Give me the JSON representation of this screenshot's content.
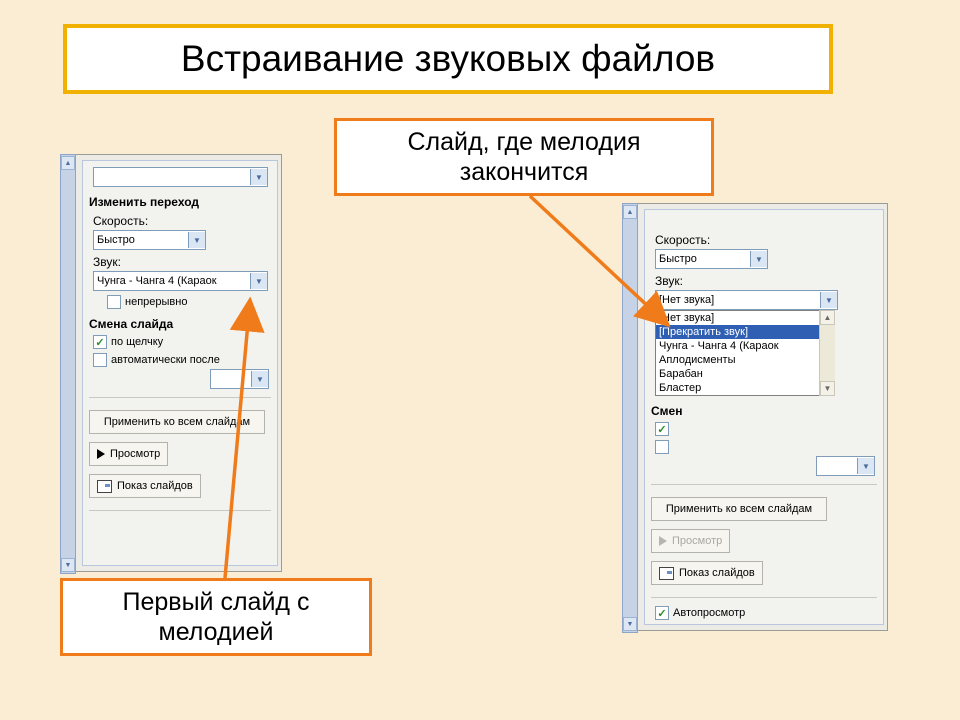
{
  "title": "Встраивание звуковых файлов",
  "callouts": {
    "top": "Слайд, где мелодия закончится",
    "bottom": "Первый слайд с мелодией"
  },
  "colors": {
    "accent": "#f07b1a",
    "title_border": "#f1b100"
  },
  "left_panel": {
    "section_transition": "Изменить переход",
    "speed_label": "Скорость:",
    "speed_value": "Быстро",
    "sound_label": "Звук:",
    "sound_value": "Чунга - Чанга 4 (Караок",
    "loop_label": "непрерывно",
    "loop_checked": false,
    "section_advance": "Смена слайда",
    "advance_click": "по щелчку",
    "advance_click_checked": true,
    "advance_auto": "автоматически после",
    "advance_auto_checked": false,
    "apply_all": "Применить ко всем слайдам",
    "play": "Просмотр",
    "slideshow": "Показ слайдов"
  },
  "right_panel": {
    "speed_label": "Скорость:",
    "speed_value": "Быстро",
    "sound_label": "Звук:",
    "sound_value": "[Нет звука]",
    "dropdown_options": [
      "[Нет звука]",
      "[Прекратить звук]",
      "Чунга - Чанга 4 (Караок",
      "Аплодисменты",
      "Барабан",
      "Бластер"
    ],
    "selected_index": 1,
    "section_advance_short": "Смен",
    "apply_all": "Применить ко всем слайдам",
    "play": "Просмотр",
    "slideshow": "Показ слайдов",
    "autopreview": "Автопросмотр",
    "autopreview_checked": true
  }
}
